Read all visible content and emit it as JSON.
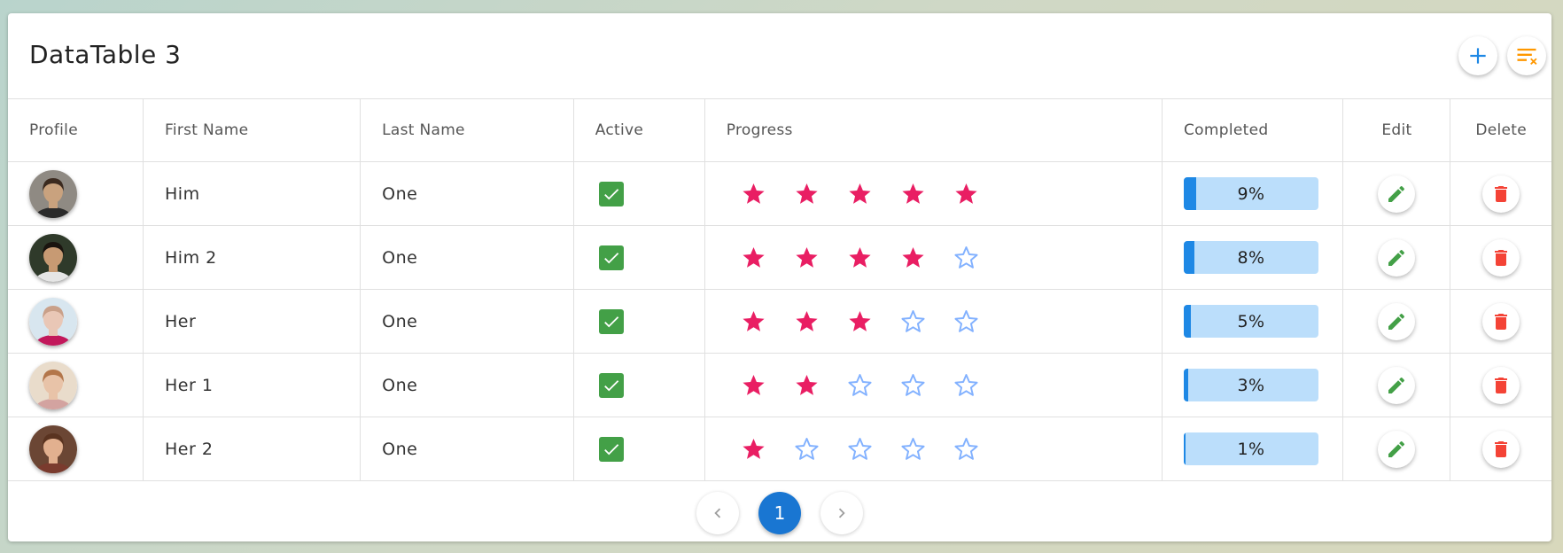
{
  "title": "DataTable 3",
  "columns": [
    "Profile",
    "First Name",
    "Last Name",
    "Active",
    "Progress",
    "Completed",
    "Edit",
    "Delete"
  ],
  "icons": {
    "add": "plus-icon",
    "clear_filter": "filter-clear-icon",
    "edit": "pencil-icon",
    "delete": "trash-icon",
    "prev": "chevron-left-icon",
    "next": "chevron-right-icon"
  },
  "colors": {
    "accent": "#1976d2",
    "star_filled": "#e91e63",
    "star_empty": "#82b1ff",
    "active": "#43a047",
    "edit": "#43a047",
    "delete": "#f44336",
    "progress_fill": "#1e88e5",
    "progress_track": "#bbdefb",
    "filter_clear": "#ff9800"
  },
  "rows": [
    {
      "first": "Him",
      "last": "One",
      "active": true,
      "rating": 5,
      "completed": 9,
      "completed_label": "9%",
      "avatar": {
        "skin": "#c9a27e",
        "hair": "#3b2a1f",
        "bg": "#8f8a83",
        "shirt": "#2b2b2b"
      }
    },
    {
      "first": "Him 2",
      "last": "One",
      "active": true,
      "rating": 4,
      "completed": 8,
      "completed_label": "8%",
      "avatar": {
        "skin": "#c79a73",
        "hair": "#1a140f",
        "bg": "#2f3a2a",
        "shirt": "#e6e6e6"
      }
    },
    {
      "first": "Her",
      "last": "One",
      "active": true,
      "rating": 3,
      "completed": 5,
      "completed_label": "5%",
      "avatar": {
        "skin": "#e9c7b6",
        "hair": "#c9a089",
        "bg": "#d8e6ef",
        "shirt": "#c2185b"
      }
    },
    {
      "first": "Her 1",
      "last": "One",
      "active": true,
      "rating": 2,
      "completed": 3,
      "completed_label": "3%",
      "avatar": {
        "skin": "#e8c3a8",
        "hair": "#b3764a",
        "bg": "#e9dccb",
        "shirt": "#d3a3a0"
      }
    },
    {
      "first": "Her 2",
      "last": "One",
      "active": true,
      "rating": 1,
      "completed": 1,
      "completed_label": "1%",
      "avatar": {
        "skin": "#e2b08f",
        "hair": "#5a3320",
        "bg": "#6b4634",
        "shirt": "#7a3b2e"
      }
    }
  ],
  "pagination": {
    "pages": [
      "1"
    ],
    "current": "1"
  }
}
